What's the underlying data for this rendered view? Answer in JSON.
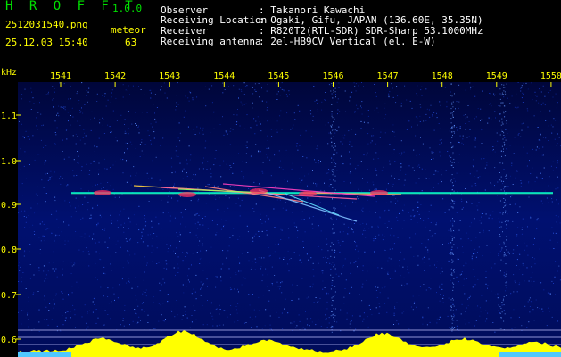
{
  "header": {
    "app_title": "H R O F F T",
    "version": "1.0.0",
    "filename": "2512031540.png",
    "datetime": "25.12.03 15:40",
    "meteor_label": "meteor",
    "meteor_count": "63",
    "fields": [
      {
        "label": "Observer",
        "value": ": Takanori Kawachi"
      },
      {
        "label": "Receiving Location",
        "value": ": Ogaki, Gifu, JAPAN (136.60E, 35.35N)"
      },
      {
        "label": "Receiver",
        "value": ": R820T2(RTL-SDR) SDR-Sharp 53.1000MHz"
      },
      {
        "label": "Receiving antenna",
        "value": ": 2el-HB9CV Vertical (el. E-W)"
      }
    ]
  },
  "plot": {
    "y_unit": "kHz",
    "x_ticks": [
      "1541",
      "1542",
      "1543",
      "1544",
      "1545",
      "1546",
      "1547",
      "1548",
      "1549",
      "1550"
    ],
    "y_ticks": [
      "1.1",
      "1.0",
      "0.9",
      "0.8",
      "0.7",
      "0.6"
    ],
    "colors": {
      "background": "#000c5a",
      "axis_text": "#ffff00",
      "signal": "#00ffcc",
      "power": "#ffff00"
    }
  }
}
